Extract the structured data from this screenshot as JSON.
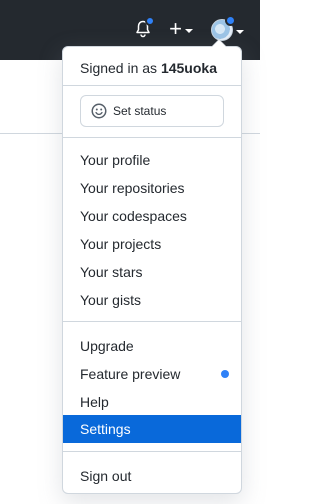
{
  "topbar": {
    "icons": [
      "bell-icon",
      "plus-icon",
      "avatar"
    ],
    "notification_dot_color": "#2f81f7"
  },
  "menu": {
    "signed_in_prefix": "Signed in as",
    "username": "145uoka",
    "set_status": "Set status",
    "group1": [
      "Your profile",
      "Your repositories",
      "Your codespaces",
      "Your projects",
      "Your stars",
      "Your gists"
    ],
    "group2": [
      "Upgrade",
      "Feature preview",
      "Help",
      "Settings"
    ],
    "sign_out": "Sign out",
    "active_item": "Settings",
    "accent_color": "#0969da"
  }
}
